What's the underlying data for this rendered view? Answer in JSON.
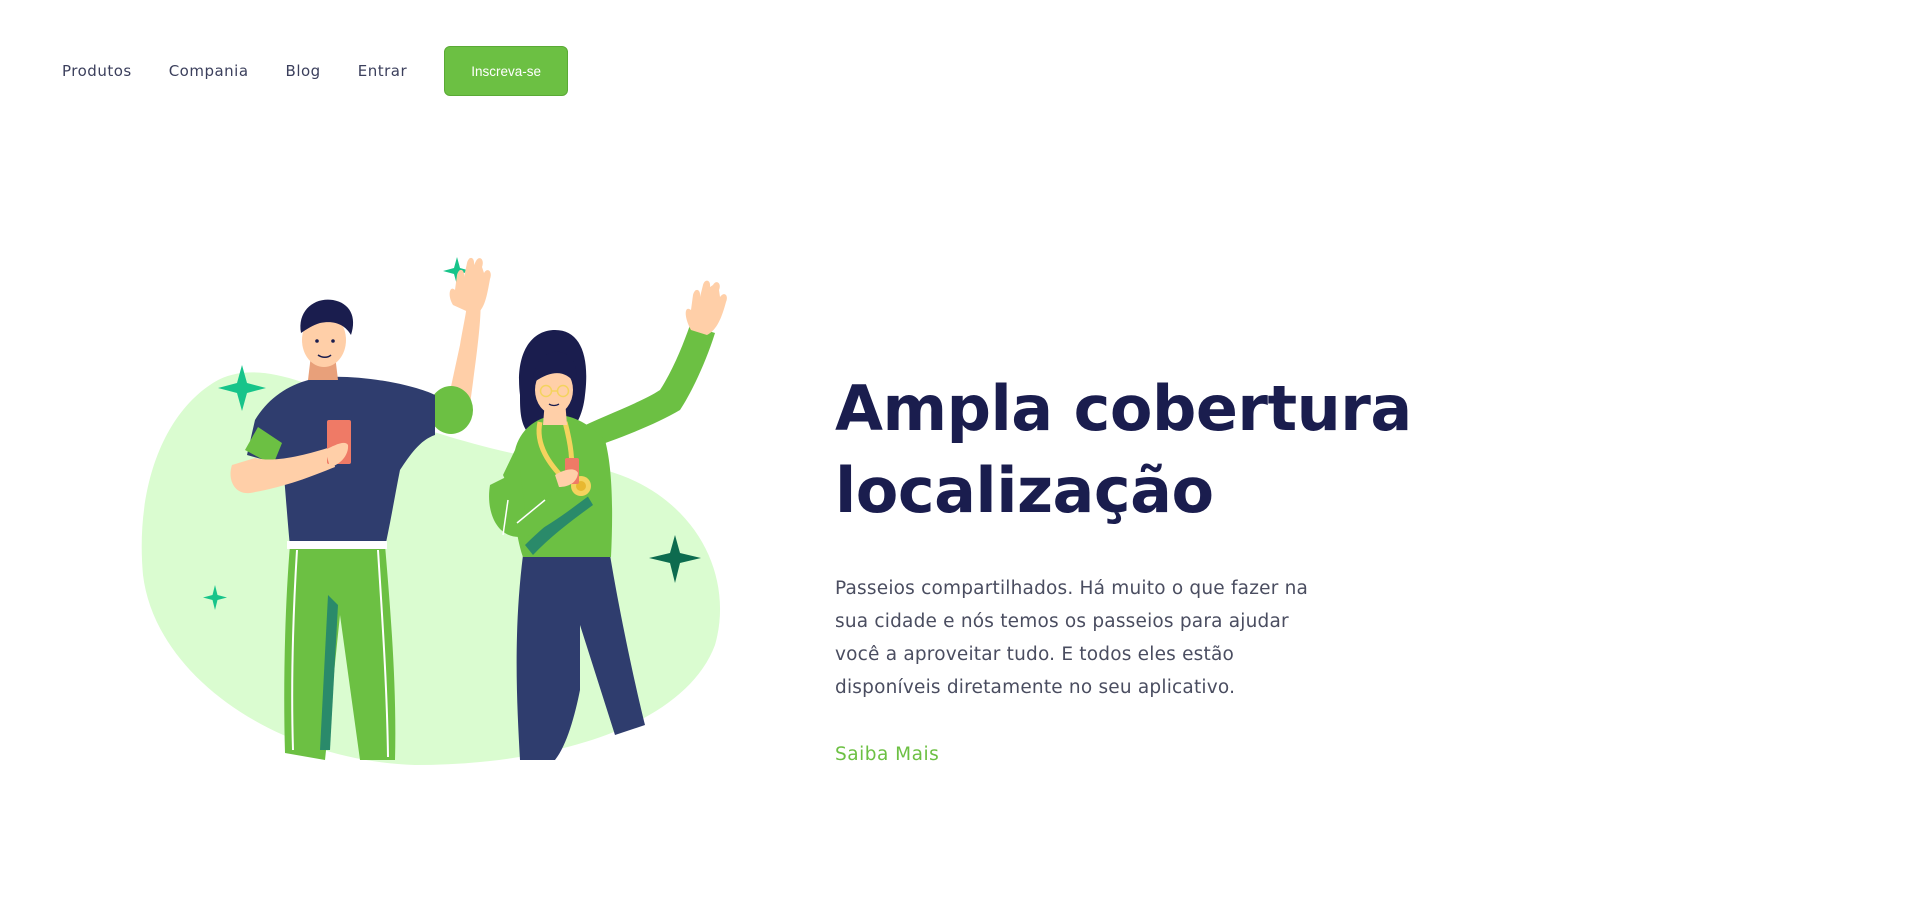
{
  "nav": {
    "links": [
      {
        "label": "Produtos"
      },
      {
        "label": "Compania"
      },
      {
        "label": "Blog"
      },
      {
        "label": "Entrar"
      }
    ],
    "cta_label": "Inscreva-se"
  },
  "hero": {
    "title_line1": "Ampla cobertura",
    "title_line2": "localização",
    "description": "Passeios compartilhados. Há muito o que fazer na sua cidade e nós temos os passeios para ajudar você a aproveitar tudo. E todos eles estão disponíveis diretamente no seu aplicativo.",
    "link_label": "Saiba Mais"
  },
  "colors": {
    "brand_green": "#6cc043",
    "title_navy": "#1a1d4e",
    "blob_green": "#dafcd0",
    "sparkle_teal": "#17c48a",
    "sparkle_dark": "#0d6b4f"
  }
}
